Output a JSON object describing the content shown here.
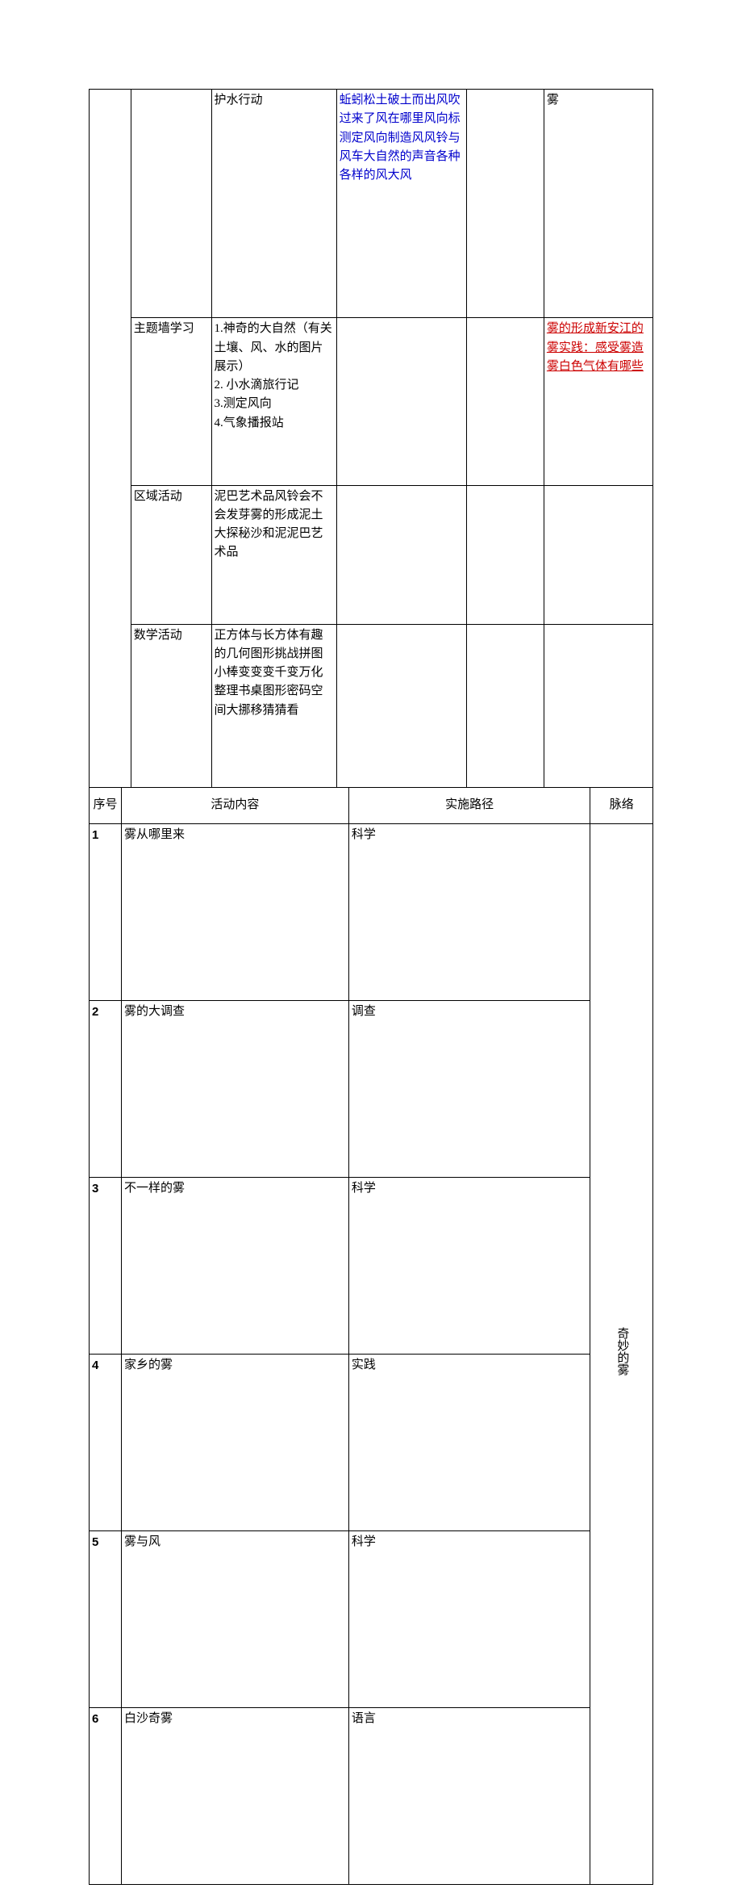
{
  "table1": {
    "row1": {
      "col3": "护水行动",
      "col4": "蚯蚓松土破土而出风吹过来了风在哪里风向标测定风向制造风风铃与风车大自然的声音各种各样的风大风",
      "col6": "雾"
    },
    "row2": {
      "col2": "主题墙学习",
      "col3": "1.神奇的大自然（有关土壤、风、水的图片展示）\n2. 小水滴旅行记\n3.测定风向\n4.气象播报站",
      "col6": "雾的形成新安江的雾实践：感受雾造雾白色气体有哪些"
    },
    "row3": {
      "col2": "区域活动",
      "col3": "泥巴艺术品风铃会不会发芽雾的形成泥土大探秘沙和泥泥巴艺术品"
    },
    "row4": {
      "col2": "数学活动",
      "col3": "正方体与长方体有趣的几何图形挑战拼图小棒变变变千变万化整理书桌图形密码空间大挪移猜猜看"
    }
  },
  "table2": {
    "headers": {
      "seq": "序号",
      "content": "活动内容",
      "path": "实施路径",
      "thread": "脉络"
    },
    "rows": [
      {
        "n": "1",
        "content": "雾从哪里来",
        "path": "科学"
      },
      {
        "n": "2",
        "content": "雾的大调查",
        "path": "调查"
      },
      {
        "n": "3",
        "content": "不一样的雾",
        "path": "科学"
      },
      {
        "n": "4",
        "content": "家乡的雾",
        "path": "实践"
      },
      {
        "n": "5",
        "content": "雾与风",
        "path": "科学"
      },
      {
        "n": "6",
        "content": "白沙奇雾",
        "path": "语言"
      }
    ],
    "thread": "奇妙的雾"
  }
}
